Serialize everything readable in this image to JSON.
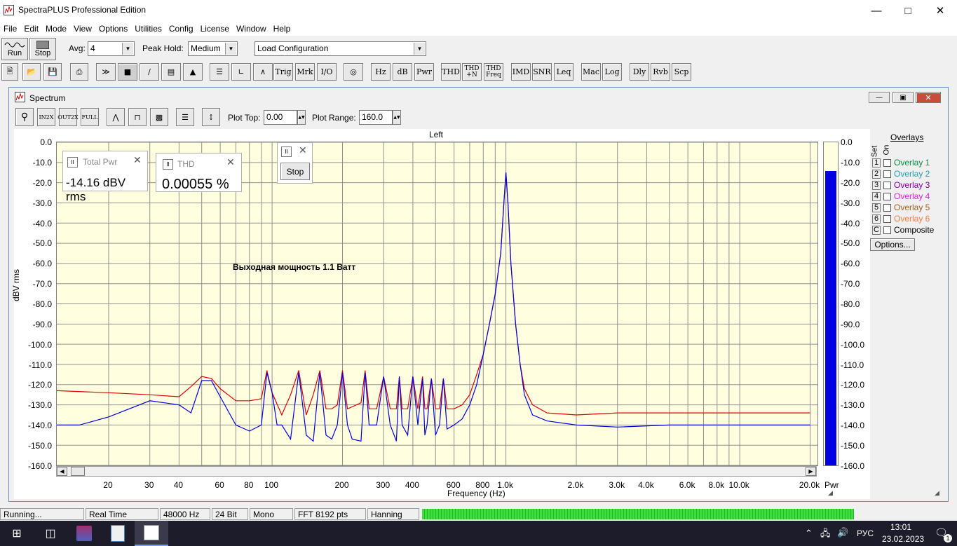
{
  "app": {
    "title": "SpectraPLUS Professional Edition"
  },
  "menu": [
    "File",
    "Edit",
    "Mode",
    "View",
    "Options",
    "Utilities",
    "Config",
    "License",
    "Window",
    "Help"
  ],
  "toolbar1": {
    "run_label": "Run",
    "stop_label": "Stop",
    "avg_label": "Avg:",
    "avg_value": "4",
    "peak_hold_label": "Peak Hold:",
    "peak_hold_value": "Medium",
    "config_value": "Load Configuration"
  },
  "toolbar2": {
    "text_buttons": [
      "Trig",
      "Mrk",
      "I/O",
      "Hz",
      "dB",
      "Pwr",
      "THD",
      "THD +N",
      "THD Freq",
      "IMD",
      "SNR",
      "Leq",
      "Mac",
      "Log",
      "Dly",
      "Rvb",
      "Scp"
    ]
  },
  "spectrum_window": {
    "title": "Spectrum",
    "plot_top_label": "Plot Top:",
    "plot_top_value": "0.00",
    "plot_range_label": "Plot Range:",
    "plot_range_value": "160.0",
    "channel_label": "Left",
    "annotation": "Выходная мощность 1.1 Ватт",
    "total_pwr": {
      "title": "Total Pwr",
      "value": "-14.16 dBV rms"
    },
    "thd": {
      "title": "THD",
      "value": "0.00055 %"
    },
    "stop_button": "Stop",
    "bar_meter_label": "Pwr",
    "bar_level_dbv": -14.16
  },
  "overlays": {
    "title": "Overlays",
    "set_label": "Set",
    "on_label": "On",
    "items": [
      {
        "key": "1",
        "label": "Overlay 1",
        "color": "#009040"
      },
      {
        "key": "2",
        "label": "Overlay 2",
        "color": "#20a0b0"
      },
      {
        "key": "3",
        "label": "Overlay 3",
        "color": "#8000a0"
      },
      {
        "key": "4",
        "label": "Overlay 4",
        "color": "#e020e0"
      },
      {
        "key": "5",
        "label": "Overlay 5",
        "color": "#a06020"
      },
      {
        "key": "6",
        "label": "Overlay 6",
        "color": "#f08040"
      },
      {
        "key": "C",
        "label": "Composite",
        "color": "#000000"
      }
    ],
    "options_button": "Options..."
  },
  "chart_data": {
    "type": "line",
    "title": "Left",
    "xlabel": "Frequency (Hz)",
    "ylabel": "dBV rms",
    "x_scale": "log",
    "xlim": [
      12,
      21500
    ],
    "ylim": [
      -160,
      0
    ],
    "grid": true,
    "y_ticks_left": [
      "0.0",
      "-10.0",
      "-20.0",
      "-30.0",
      "-40.0",
      "-50.0",
      "-60.0",
      "-70.0",
      "-80.0",
      "-90.0",
      "-100.0",
      "-110.0",
      "-120.0",
      "-130.0",
      "-140.0",
      "-150.0",
      "-160.0"
    ],
    "y_ticks_right": [
      "0.0",
      "-10.0",
      "-20.0",
      "-30.0",
      "-40.0",
      "-50.0",
      "-60.0",
      "-70.0",
      "-80.0",
      "-90.0",
      "-100.0",
      "-110.0",
      "-120.0",
      "-130.0",
      "-140.0",
      "-150.0",
      "-160.0"
    ],
    "x_tick_values": [
      20,
      30,
      40,
      60,
      80,
      100,
      200,
      300,
      400,
      600,
      800,
      1000,
      2000,
      3000,
      4000,
      6000,
      8000,
      10000,
      20000
    ],
    "x_tick_labels": [
      "20",
      "30",
      "40",
      "60",
      "80",
      "100",
      "200",
      "300",
      "400",
      "600",
      "800",
      "1.0k",
      "2.0k",
      "3.0k",
      "4.0k",
      "6.0k",
      "8.0k",
      "10.0k",
      "20.0k"
    ],
    "series": [
      {
        "color": "#e00000",
        "x": [
          12,
          20,
          30,
          40,
          45,
          50,
          55,
          60,
          70,
          80,
          90,
          95,
          100,
          110,
          120,
          130,
          140,
          150,
          160,
          170,
          180,
          190,
          200,
          210,
          220,
          240,
          250,
          260,
          280,
          300,
          320,
          340,
          350,
          360,
          380,
          400,
          420,
          440,
          450,
          460,
          480,
          500,
          520,
          540,
          560,
          600,
          650,
          700,
          750,
          800,
          850,
          900,
          950,
          980,
          1000,
          1020,
          1050,
          1100,
          1150,
          1200,
          1300,
          1500,
          2000,
          3000,
          5000,
          8000,
          12000,
          16000,
          20000
        ],
        "y": [
          -123,
          -124,
          -125,
          -126,
          -121,
          -116,
          -117,
          -122,
          -128,
          -128,
          -127,
          -113,
          -124,
          -135,
          -125,
          -113,
          -135,
          -125,
          -113,
          -132,
          -132,
          -130,
          -113,
          -132,
          -131,
          -129,
          -113,
          -132,
          -132,
          -116,
          -132,
          -132,
          -116,
          -132,
          -132,
          -116,
          -132,
          -116,
          -132,
          -132,
          -117,
          -132,
          -132,
          -117,
          -132,
          -132,
          -130,
          -125,
          -115,
          -105,
          -90,
          -75,
          -55,
          -30,
          -15,
          -30,
          -60,
          -90,
          -110,
          -122,
          -130,
          -134,
          -135,
          -134,
          -134,
          -134,
          -134,
          -134,
          -134
        ]
      },
      {
        "color": "#0000e0",
        "x": [
          12,
          15,
          20,
          30,
          40,
          45,
          50,
          55,
          60,
          70,
          80,
          90,
          95,
          100,
          105,
          110,
          120,
          130,
          140,
          150,
          160,
          170,
          180,
          190,
          200,
          210,
          220,
          240,
          250,
          260,
          280,
          300,
          320,
          340,
          350,
          360,
          380,
          400,
          420,
          440,
          450,
          460,
          480,
          500,
          520,
          540,
          560,
          600,
          650,
          700,
          750,
          800,
          850,
          900,
          950,
          980,
          1000,
          1020,
          1050,
          1100,
          1150,
          1200,
          1300,
          1500,
          2000,
          3000,
          5000,
          8000,
          12000,
          16000,
          20000
        ],
        "y": [
          -140,
          -140,
          -136,
          -128,
          -130,
          -134,
          -118,
          -118,
          -126,
          -140,
          -143,
          -140,
          -114,
          -124,
          -140,
          -140,
          -147,
          -114,
          -145,
          -148,
          -114,
          -145,
          -147,
          -140,
          -114,
          -140,
          -147,
          -148,
          -114,
          -140,
          -140,
          -116,
          -140,
          -148,
          -116,
          -140,
          -145,
          -116,
          -140,
          -117,
          -145,
          -140,
          -117,
          -145,
          -140,
          -117,
          -142,
          -140,
          -137,
          -130,
          -120,
          -105,
          -90,
          -75,
          -55,
          -30,
          -15,
          -30,
          -60,
          -90,
          -110,
          -125,
          -135,
          -138,
          -140,
          -141,
          -140,
          -140,
          -140,
          -140,
          -140
        ]
      }
    ]
  },
  "statusbar": {
    "state": "Running...",
    "mode": "Real Time",
    "rate": "48000 Hz",
    "bits": "24 Bit",
    "channels": "Mono",
    "fft": "FFT 8192 pts",
    "window": "Hanning"
  },
  "taskbar": {
    "lang": "РУС",
    "time": "13:01",
    "date": "23.02.2023",
    "notif_count": "1"
  }
}
